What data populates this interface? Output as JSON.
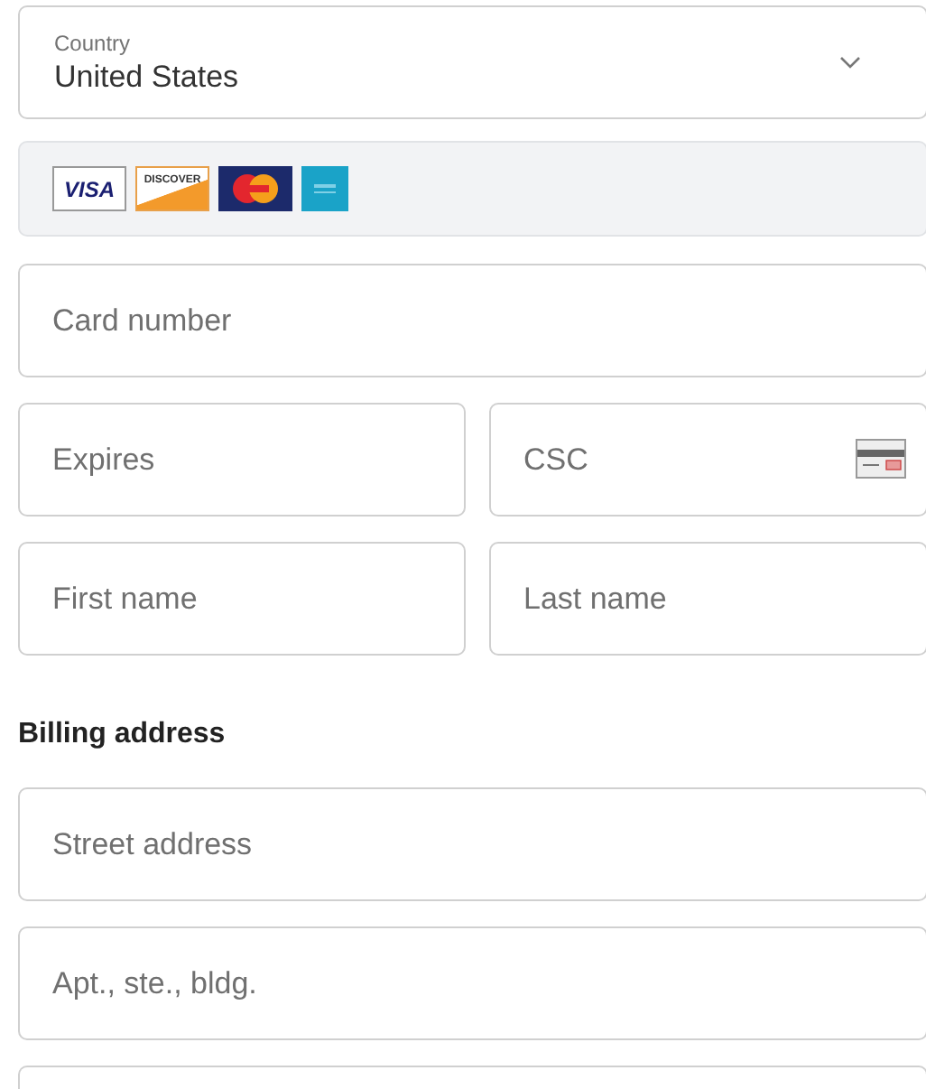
{
  "country": {
    "label": "Country",
    "value": "United States"
  },
  "card_logos": [
    {
      "kind": "visa",
      "text": "VISA"
    },
    {
      "kind": "discover",
      "text": "DISCOVER"
    },
    {
      "kind": "mastercard"
    },
    {
      "kind": "amex"
    }
  ],
  "card_number": {
    "placeholder": "Card number"
  },
  "expires": {
    "placeholder": "Expires"
  },
  "csc": {
    "placeholder": "CSC"
  },
  "first_name": {
    "placeholder": "First name"
  },
  "last_name": {
    "placeholder": "Last name"
  },
  "billing_heading": "Billing address",
  "street": {
    "placeholder": "Street address"
  },
  "apt": {
    "placeholder": "Apt., ste., bldg."
  }
}
